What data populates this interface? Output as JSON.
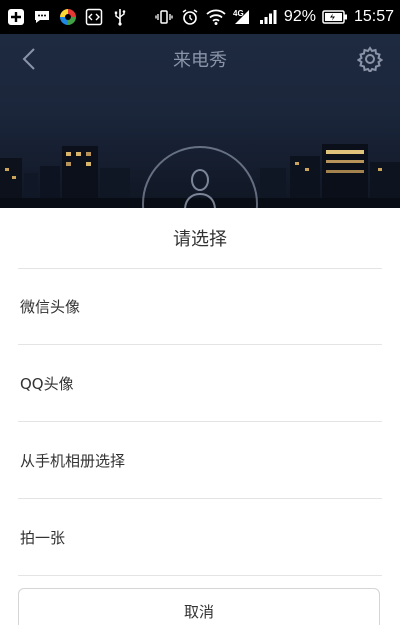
{
  "status_bar": {
    "battery_percent": "92%",
    "time": "15:57",
    "network_label": "4G",
    "icons": [
      "add-icon",
      "message-icon",
      "color-wheel-icon",
      "code-icon",
      "usb-icon",
      "vibrate-icon",
      "alarm-icon",
      "wifi-icon",
      "signal-4g-icon",
      "signal-icon",
      "battery-icon"
    ]
  },
  "header": {
    "title": "来电秀",
    "back_icon": "chevron-left-icon",
    "settings_icon": "gear-icon",
    "avatar_icon": "person-icon"
  },
  "sheet": {
    "title": "请选择",
    "options": [
      {
        "label": "微信头像"
      },
      {
        "label": "QQ头像"
      },
      {
        "label": "从手机相册选择"
      },
      {
        "label": "拍一张"
      }
    ],
    "cancel_label": "取消"
  },
  "colors": {
    "header_bg": "#1b263b",
    "title_text": "#8a93a8",
    "sheet_bg": "#ffffff",
    "divider": "#e4e4e4",
    "text": "#333333"
  }
}
